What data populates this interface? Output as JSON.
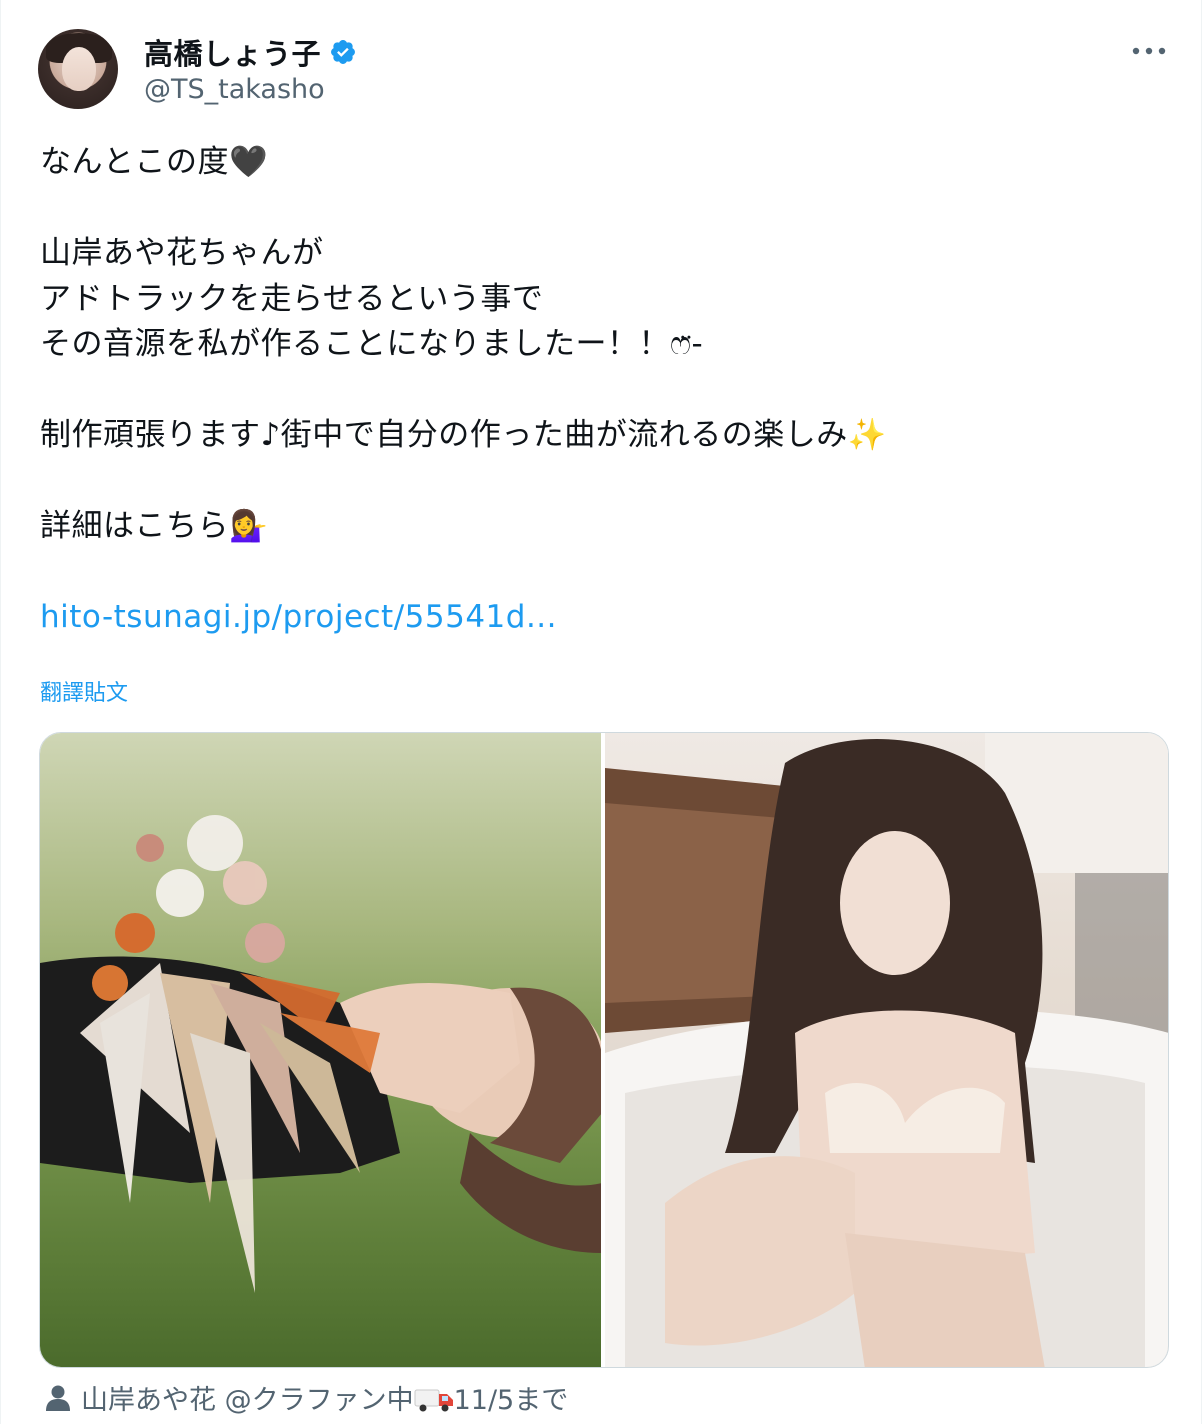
{
  "author": {
    "display_name": "高橋しょう子",
    "handle": "@TS_takasho",
    "verified": true
  },
  "tweet": {
    "lines": [
      "なんとこの度🖤",
      "",
      "山岸あや花ちゃんが",
      "アドトラックを走らせるという事で",
      "その音源を私が作ることになりましたー！！ෆ̈-",
      "",
      "制作頑張ります♪街中で自分の作った曲が流れるの楽しみ✨",
      "",
      "詳細はこちら💁‍♀️",
      ""
    ],
    "link_text": "hito-tsunagi.jp/project/55541d...",
    "translate_label": "翻譯貼文"
  },
  "media": {
    "photos": [
      {
        "desc": "photo-1"
      },
      {
        "desc": "photo-2"
      }
    ]
  },
  "tagged_user": {
    "label_prefix": "山岸あや花 @クラファン中",
    "label_suffix": "11/5まで"
  },
  "colors": {
    "link": "#1d9bf0",
    "secondary_text": "#536471",
    "primary_text": "#0f1419",
    "verified_badge": "#1d9bf0"
  },
  "icons": [
    "more-icon",
    "verified-badge-icon",
    "person-icon",
    "truck-icon"
  ]
}
